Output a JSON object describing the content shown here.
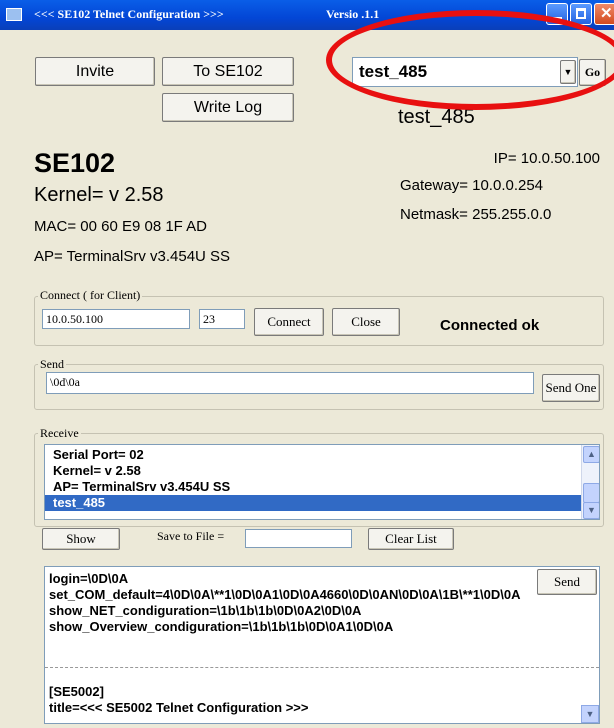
{
  "window": {
    "title": "<<< SE102 Telnet Configuration >>>",
    "version": "Versio  .1.1"
  },
  "buttons": {
    "invite": "Invite",
    "to_se102": "To SE102",
    "write_log": "Write Log",
    "go": "Go",
    "connect": "Connect",
    "close": "Close",
    "send_one": "Send One",
    "show": "Show",
    "clear_list": "Clear List",
    "send": "Send"
  },
  "selector": {
    "value": "test_485",
    "label": "test_485"
  },
  "device": {
    "name": "SE102",
    "kernel": "Kernel= v 2.58",
    "mac": "MAC= 00 60 E9 08 1F AD",
    "ap": "AP= TerminalSrv v3.454U    SS",
    "ip": "IP= 10.0.50.100",
    "gateway": "Gateway= 10.0.0.254",
    "netmask": "Netmask= 255.255.0.0"
  },
  "connect": {
    "legend": "Connect ( for Client)",
    "ip": "10.0.50.100",
    "port": "23",
    "status": "Connected ok"
  },
  "send": {
    "legend": "Send",
    "value": "\\0d\\0a"
  },
  "receive": {
    "legend": "Receive",
    "items": [
      "Serial Port= 02",
      "Kernel= v 2.58",
      "AP= TerminalSrv v3.454U     SS",
      "test_485"
    ]
  },
  "save": {
    "label": "Save to File =",
    "value": ""
  },
  "script": {
    "lines": [
      "login=\\0D\\0A",
      "set_COM_default=4\\0D\\0A\\**1\\0D\\0A1\\0D\\0A4660\\0D\\0AN\\0D\\0A\\1B\\**1\\0D\\0A",
      "show_NET_condiguration=\\1b\\1b\\1b\\0D\\0A2\\0D\\0A",
      "show_Overview_condiguration=\\1b\\1b\\1b\\0D\\0A1\\0D\\0A",
      "",
      "",
      "",
      "[SE5002]",
      "title=<<< SE5002 Telnet Configuration >>>"
    ]
  },
  "colors": {
    "titlebar": "#0346d6",
    "selection": "#316ac5",
    "annotation": "#e81010",
    "face": "#ece9d8"
  }
}
